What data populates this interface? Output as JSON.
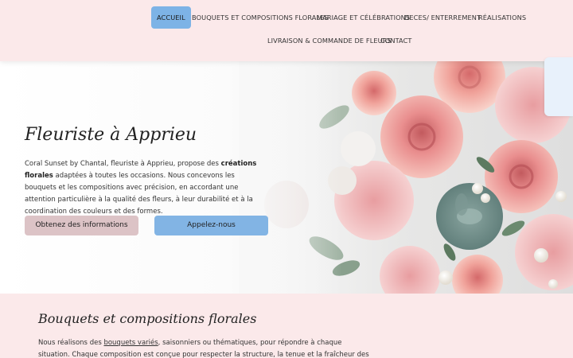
{
  "nav": {
    "items": [
      {
        "label": "ACCUEIL",
        "active": true
      },
      {
        "label": "BOUQUETS ET COMPOSITIONS FLORALES"
      },
      {
        "label": "MARIAGE ET CÉLÉBRATIONS"
      },
      {
        "label": "DECES/ ENTERREMENT"
      },
      {
        "label": "RÉALISATIONS"
      },
      {
        "label": "LIVRAISON & COMMANDE DE FLEURS"
      },
      {
        "label": "CONTACT"
      }
    ]
  },
  "hero": {
    "title": "Fleuriste à Apprieu",
    "text_before": "Coral Sunset by Chantal, fleuriste à Apprieu, propose des ",
    "text_bold": "créations florales",
    "text_after": " adaptées à toutes les occasions. Nous concevons les bouquets et les compositions avec précision, en accordant une attention particulière à la qualité des fleurs, à leur durabilité et à la coordination des couleurs et des formes.",
    "btn_info": "Obtenez des informations",
    "btn_call": "Appelez-nous"
  },
  "section": {
    "title": "Bouquets et compositions florales",
    "text_before": "Nous réalisons des ",
    "text_link": "bouquets variés",
    "text_after": ", saisonniers ou thématiques, pour répondre à chaque situation. Chaque composition est conçue pour respecter la structure, la tenue et la fraîcheur des fleurs, tout en"
  },
  "colors": {
    "page_bg": "#fbe9ea",
    "nav_active": "#7db3e6",
    "btn_info": "#dcc3c6",
    "btn_call": "#82b4e4"
  }
}
